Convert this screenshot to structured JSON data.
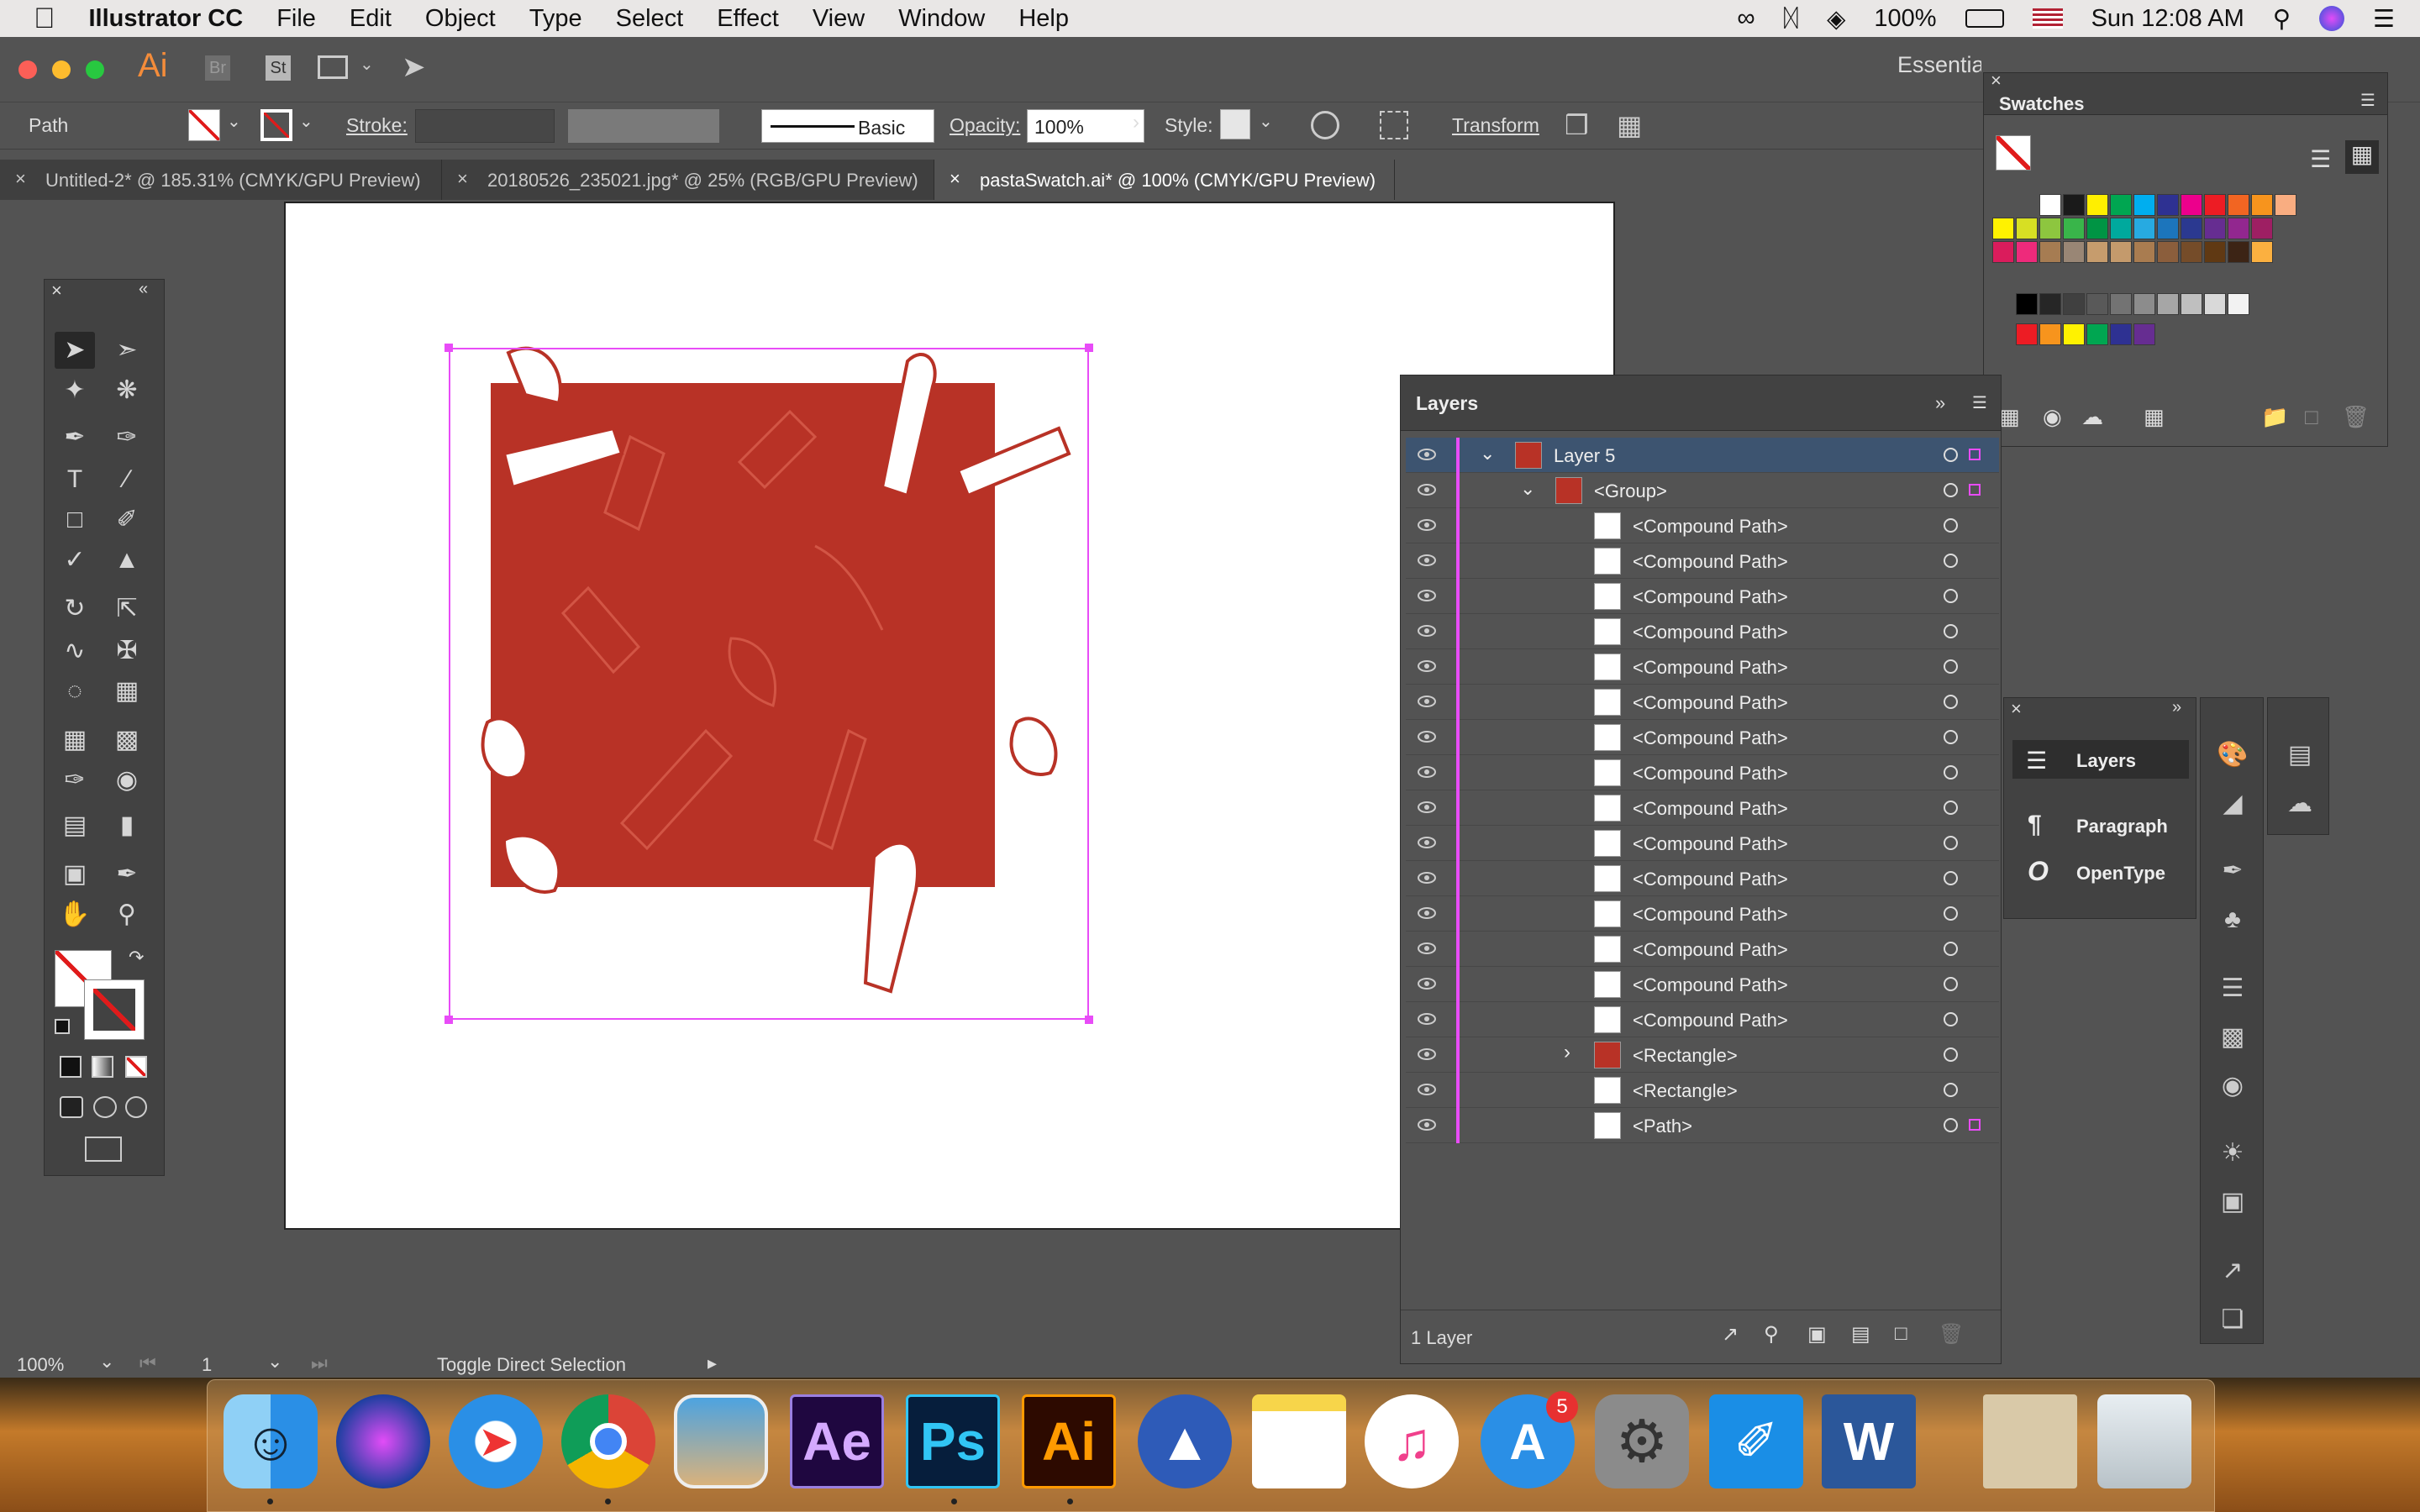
{
  "menubar": {
    "app": "Illustrator CC",
    "items": [
      "File",
      "Edit",
      "Object",
      "Type",
      "Select",
      "Effect",
      "View",
      "Window",
      "Help"
    ],
    "battery": "100%",
    "clock": "Sun 12:08 AM"
  },
  "appbar": {
    "ai_label": "Ai",
    "br_label": "Br",
    "st_label": "St",
    "workspace": "Essentials"
  },
  "controlbar": {
    "selection_type": "Path",
    "stroke_label": "Stroke:",
    "brush_label": "Basic",
    "opacity_label": "Opacity:",
    "opacity_value": "100%",
    "style_label": "Style:",
    "transform_label": "Transform"
  },
  "tabs": [
    {
      "label": "Untitled-2* @ 185.31% (CMYK/GPU Preview)"
    },
    {
      "label": "20180526_235021.jpg* @ 25% (RGB/GPU Preview)"
    },
    {
      "label": "pastaSwatch.ai* @ 100% (CMYK/GPU Preview)"
    }
  ],
  "layers_panel": {
    "title": "Layers",
    "rows": [
      {
        "name": "Layer 5",
        "level": 0
      },
      {
        "name": "<Group>",
        "level": 1
      },
      {
        "name": "<Compound Path>",
        "level": 2
      },
      {
        "name": "<Compound Path>",
        "level": 2
      },
      {
        "name": "<Compound Path>",
        "level": 2
      },
      {
        "name": "<Compound Path>",
        "level": 2
      },
      {
        "name": "<Compound Path>",
        "level": 2
      },
      {
        "name": "<Compound Path>",
        "level": 2
      },
      {
        "name": "<Compound Path>",
        "level": 2
      },
      {
        "name": "<Compound Path>",
        "level": 2
      },
      {
        "name": "<Compound Path>",
        "level": 2
      },
      {
        "name": "<Compound Path>",
        "level": 2
      },
      {
        "name": "<Compound Path>",
        "level": 2
      },
      {
        "name": "<Compound Path>",
        "level": 2
      },
      {
        "name": "<Compound Path>",
        "level": 2
      },
      {
        "name": "<Compound Path>",
        "level": 2
      },
      {
        "name": "<Compound Path>",
        "level": 2
      },
      {
        "name": "<Rectangle>",
        "level": 2
      },
      {
        "name": "<Rectangle>",
        "level": 2
      },
      {
        "name": "<Path>",
        "level": 2
      }
    ],
    "footer_count": "1 Layer"
  },
  "swatches_panel": {
    "title": "Swatches",
    "colors": {
      "row1": [
        "#ffffff",
        "#1a1a1a",
        "#ffef00",
        "#00a651",
        "#00aeef",
        "#2e3192",
        "#ec008c",
        "#ed1c24",
        "#f26522",
        "#f7941d",
        "#f9ad81"
      ],
      "row2": [
        "#fff200",
        "#d7df23",
        "#8dc63f",
        "#39b54a",
        "#009444",
        "#00a99d",
        "#27aae1",
        "#1c75bc",
        "#2b3990",
        "#662d91",
        "#92278f",
        "#9e1f63"
      ],
      "row3": [
        "#da1c5c",
        "#ee2a7b",
        "#a67c52",
        "#998675",
        "#c69c6d",
        "#c49a6c",
        "#a97c50",
        "#8b5e3c",
        "#754c29",
        "#603913",
        "#3c2415",
        "#fbb040"
      ],
      "row5": [
        "#000000",
        "#262626",
        "#404040",
        "#595959",
        "#737373",
        "#8c8c8c",
        "#a6a6a6",
        "#bfbfbf",
        "#d9d9d9",
        "#f2f2f2"
      ],
      "row6": [
        "#ed1c24",
        "#f7941d",
        "#fff200",
        "#00a651",
        "#2e3192",
        "#662d91"
      ]
    }
  },
  "float_panel": {
    "items": [
      "Layers",
      "Paragraph",
      "OpenType"
    ]
  },
  "status": {
    "zoom": "100%",
    "page": "1",
    "tool_hint": "Toggle Direct Selection"
  },
  "dock": {
    "appstore_badge": "5",
    "ae_label": "Ae",
    "ps_label": "Ps",
    "ai_label": "Ai"
  },
  "colors": {
    "pasta_red": "#b83226",
    "selection_magenta": "#e84cf7",
    "panel_bg": "#535353"
  }
}
